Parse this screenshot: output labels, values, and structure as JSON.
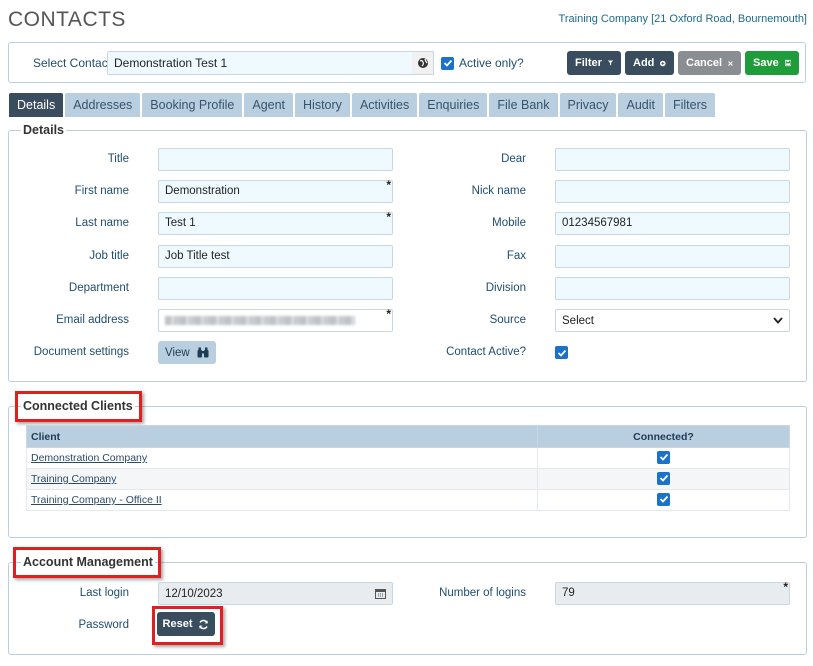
{
  "header": {
    "title": "CONTACTS",
    "company": "Training Company [21 Oxford Road, Bournemouth]"
  },
  "toolbar": {
    "select_contact_label": "Select Contact",
    "contact_value": "Demonstration Test 1",
    "active_only_label": "Active only?",
    "active_only_checked": true,
    "filter_label": "Filter",
    "add_label": "Add",
    "cancel_label": "Cancel",
    "save_label": "Save"
  },
  "tabs": [
    {
      "label": "Details",
      "active": true
    },
    {
      "label": "Addresses"
    },
    {
      "label": "Booking Profile"
    },
    {
      "label": "Agent"
    },
    {
      "label": "History"
    },
    {
      "label": "Activities"
    },
    {
      "label": "Enquiries"
    },
    {
      "label": "File Bank"
    },
    {
      "label": "Privacy"
    },
    {
      "label": "Audit"
    },
    {
      "label": "Filters"
    }
  ],
  "details": {
    "legend": "Details",
    "title_label": "Title",
    "title_value": "",
    "first_name_label": "First name",
    "first_name_value": "Demonstration",
    "last_name_label": "Last name",
    "last_name_value": "Test 1",
    "job_title_label": "Job title",
    "job_title_value": "Job Title test",
    "department_label": "Department",
    "department_value": "",
    "email_label": "Email address",
    "document_settings_label": "Document settings",
    "view_label": "View",
    "dear_label": "Dear",
    "dear_value": "",
    "nick_name_label": "Nick name",
    "nick_name_value": "",
    "mobile_label": "Mobile",
    "mobile_value": "01234567981",
    "fax_label": "Fax",
    "fax_value": "",
    "division_label": "Division",
    "division_value": "",
    "source_label": "Source",
    "source_value": "Select",
    "contact_active_label": "Contact Active?",
    "contact_active_checked": true,
    "required_marker": "*"
  },
  "connected_clients": {
    "legend": "Connected Clients",
    "col_client": "Client",
    "col_connected": "Connected?",
    "rows": [
      {
        "client": "Demonstration Company",
        "connected": true
      },
      {
        "client": "Training Company",
        "connected": true
      },
      {
        "client": "Training Company - Office II",
        "connected": true
      }
    ]
  },
  "account": {
    "legend": "Account Management",
    "last_login_label": "Last login",
    "last_login_value": "12/10/2023",
    "num_logins_label": "Number of logins",
    "num_logins_value": "79",
    "password_label": "Password",
    "reset_label": "Reset"
  },
  "colors": {
    "primary": "#394d5f",
    "save": "#1f9d3a",
    "tab_bg": "#b9cfe0",
    "field_bg": "#eefaff",
    "highlight": "#e02020"
  }
}
